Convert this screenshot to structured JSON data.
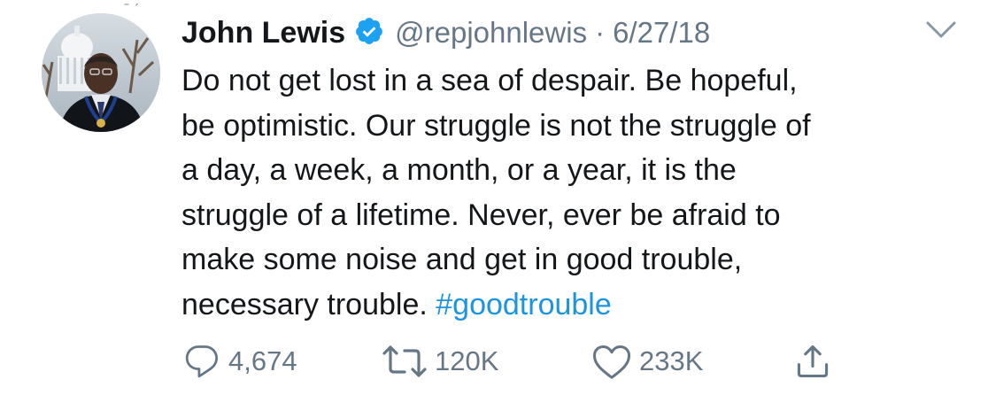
{
  "tweet": {
    "author_name": "John Lewis",
    "handle": "@repjohnlewis",
    "separator": "·",
    "date": "6/27/18",
    "text_lines": [
      "Do not get lost in a sea of despair. Be hopeful,",
      "be optimistic. Our struggle is not the struggle of",
      "a day, a week, a month, or a year, it is the",
      "struggle of a lifetime. Never, ever be afraid to",
      "make some noise and get in good trouble,",
      "necessary trouble. "
    ],
    "hashtag": "#goodtrouble",
    "verified_icon": "verified-badge-icon",
    "menu_icon": "chevron-down-icon"
  },
  "actions": {
    "reply": {
      "icon": "reply-icon",
      "count": "4,674"
    },
    "retweet": {
      "icon": "retweet-icon",
      "count": "120K"
    },
    "like": {
      "icon": "heart-icon",
      "count": "233K"
    },
    "share": {
      "icon": "share-icon"
    }
  },
  "colors": {
    "text": "#14171a",
    "secondary": "#657786",
    "link": "#1b95e0",
    "verified": "#1da1f2"
  }
}
